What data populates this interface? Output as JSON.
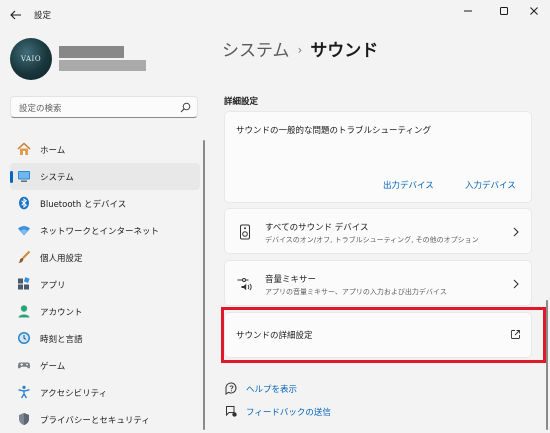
{
  "window": {
    "title": "設定"
  },
  "search": {
    "placeholder": "設定の検索"
  },
  "profile": {
    "avatar_text": "VAIO"
  },
  "nav": {
    "items": [
      {
        "label": "ホーム",
        "icon": "home-icon"
      },
      {
        "label": "システム",
        "icon": "system-icon",
        "active": true
      },
      {
        "label": "Bluetooth とデバイス",
        "icon": "bluetooth-icon"
      },
      {
        "label": "ネットワークとインターネット",
        "icon": "network-icon"
      },
      {
        "label": "個人用設定",
        "icon": "brush-icon"
      },
      {
        "label": "アプリ",
        "icon": "apps-icon"
      },
      {
        "label": "アカウント",
        "icon": "account-icon"
      },
      {
        "label": "時刻と言語",
        "icon": "time-language-icon"
      },
      {
        "label": "ゲーム",
        "icon": "gaming-icon"
      },
      {
        "label": "アクセシビリティ",
        "icon": "accessibility-icon"
      },
      {
        "label": "プライバシーとセキュリティ",
        "icon": "shield-icon"
      }
    ]
  },
  "breadcrumb": {
    "parent": "システム",
    "separator": "›",
    "current": "サウンド"
  },
  "main": {
    "section_title": "詳細設定",
    "troubleshoot": {
      "title": "サウンドの一般的な問題のトラブルシューティング",
      "output_label": "出力デバイス",
      "input_label": "入力デバイス"
    },
    "all_devices": {
      "title": "すべてのサウンド デバイス",
      "subtitle": "デバイスのオン/オフ, トラブルシューティング, その他のオプション"
    },
    "mixer": {
      "title": "音量ミキサー",
      "subtitle": "アプリの音量ミキサー、アプリの入力および出力デバイス"
    },
    "advanced": {
      "title": "サウンドの詳細設定"
    }
  },
  "help": {
    "get_help": "ヘルプを表示",
    "feedback": "フィードバックの送信"
  },
  "colors": {
    "accent": "#0067c0",
    "link": "#0062b8",
    "highlight": "#e0182a"
  }
}
